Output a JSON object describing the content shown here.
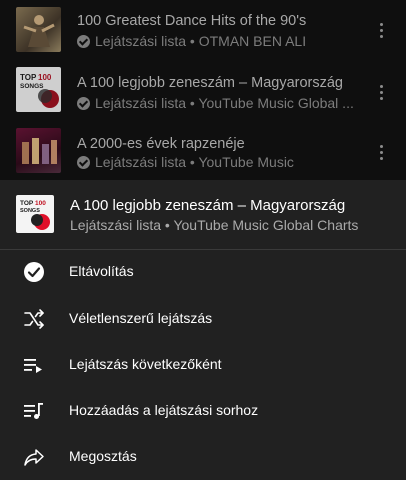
{
  "background_list": [
    {
      "title": "100 Greatest Dance Hits of the 90's",
      "subtitle": "Lejátszási lista • OTMAN BEN ALI",
      "thumb": "dance-cover"
    },
    {
      "title": "A 100 legjobb zeneszám – Magyarország",
      "subtitle": "Lejátszási lista • YouTube Music Global ...",
      "thumb": "top100-cover"
    },
    {
      "title": "A 2000-es évek rapzenéje",
      "subtitle": "Lejátszási lista • YouTube Music",
      "thumb": "rap-cover"
    }
  ],
  "sheet": {
    "title": "A 100 legjobb zeneszám – Magyarország",
    "subtitle": "Lejátszási lista • YouTube Music Global Charts",
    "thumb_text": {
      "line1": "TOP",
      "line2": "100",
      "line3": "SONGS"
    }
  },
  "menu": [
    {
      "label": "Eltávolítás",
      "icon": "check-circle-icon"
    },
    {
      "label": "Véletlenszerű lejátszás",
      "icon": "shuffle-icon"
    },
    {
      "label": "Lejátszás következőként",
      "icon": "play-next-icon"
    },
    {
      "label": "Hozzáadás a lejátszási sorhoz",
      "icon": "add-to-queue-icon"
    },
    {
      "label": "Megosztás",
      "icon": "share-icon"
    }
  ],
  "colors": {
    "sheet_bg": "#212121",
    "list_bg": "#0f0f0f",
    "accent_red": "#ff0033"
  }
}
